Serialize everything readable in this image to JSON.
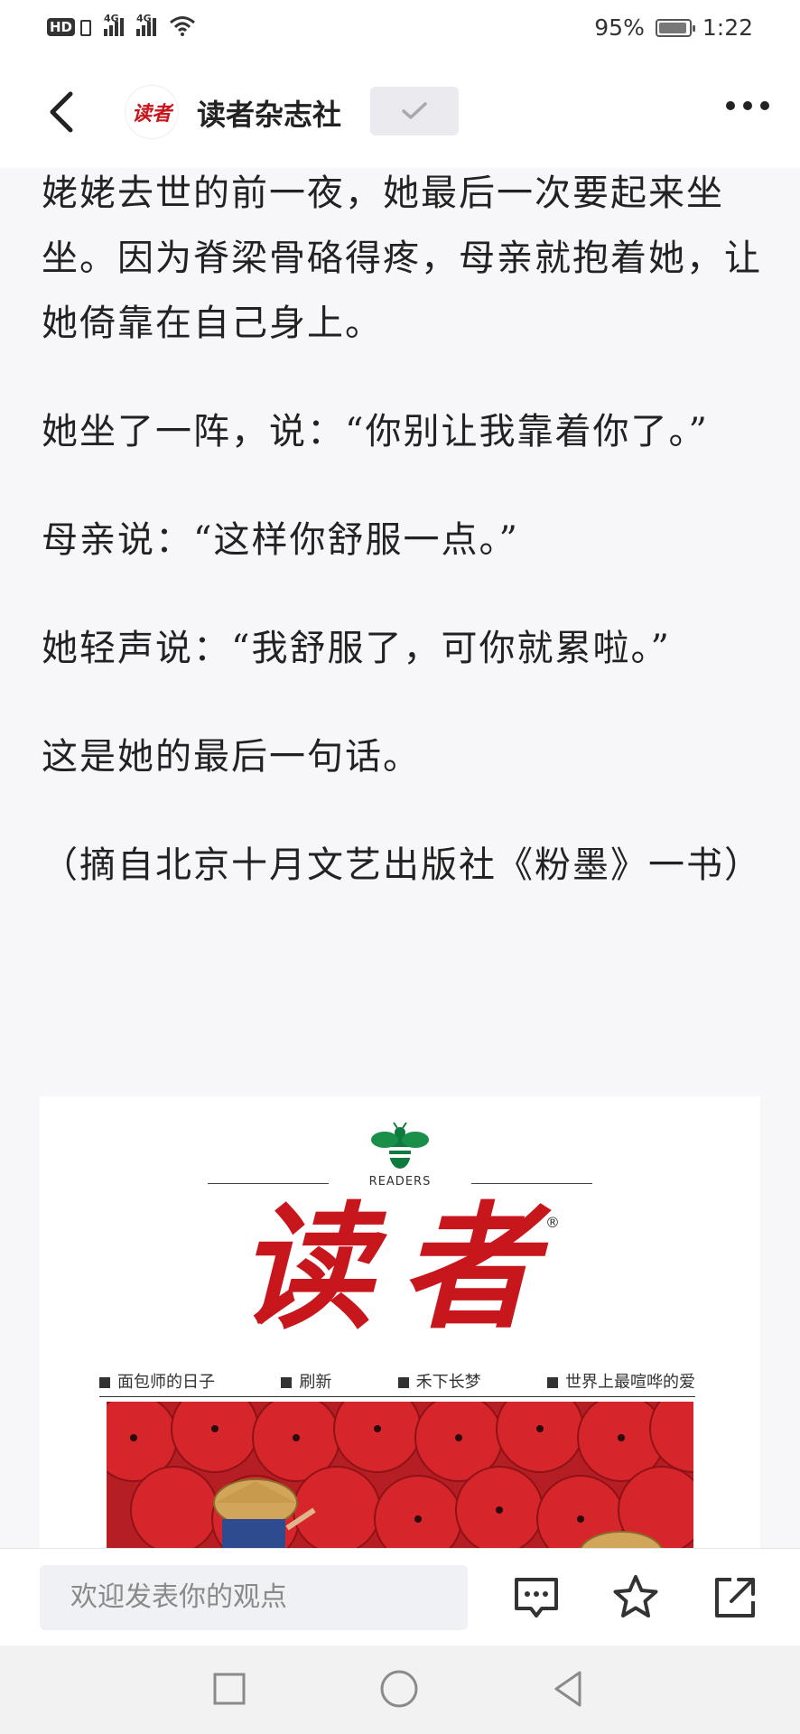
{
  "status_bar": {
    "hd": "HD",
    "sig1": "4G",
    "sig2": "4G",
    "battery_percent": "95%",
    "battery_level": 0.95,
    "time": "1:22"
  },
  "nav": {
    "logo_text": "读者",
    "title": "读者杂志社",
    "follow_state": "已关注"
  },
  "article": {
    "paragraphs": [
      "姥姥去世的前一夜，她最后一次要起来坐坐。因为脊梁骨硌得疼，母亲就抱着她，让她倚靠在自己身上。",
      "她坐了一阵，说：“你别让我靠着你了。”",
      "母亲说：“这样你舒服一点。”",
      "她轻声说：“我舒服了，可你就累啦。”",
      "这是她的最后一句话。",
      "（摘自北京十月文艺出版社《粉墨》一书）"
    ]
  },
  "cover": {
    "readers_label": "READERS",
    "brand": "读者",
    "reg_mark": "®",
    "headlines": [
      "面包师的日子",
      "刷新",
      "禾下长梦",
      "世界上最喧哗的爱"
    ],
    "colors": {
      "brand_red": "#c8161d",
      "umbrella_red": "#d6262b"
    }
  },
  "bottom_bar": {
    "comment_placeholder": "欢迎发表你的观点",
    "icons": [
      "comment-icon",
      "star-icon",
      "share-icon"
    ]
  },
  "system_nav": {
    "icons": [
      "recent-apps-icon",
      "home-icon",
      "back-icon"
    ]
  }
}
